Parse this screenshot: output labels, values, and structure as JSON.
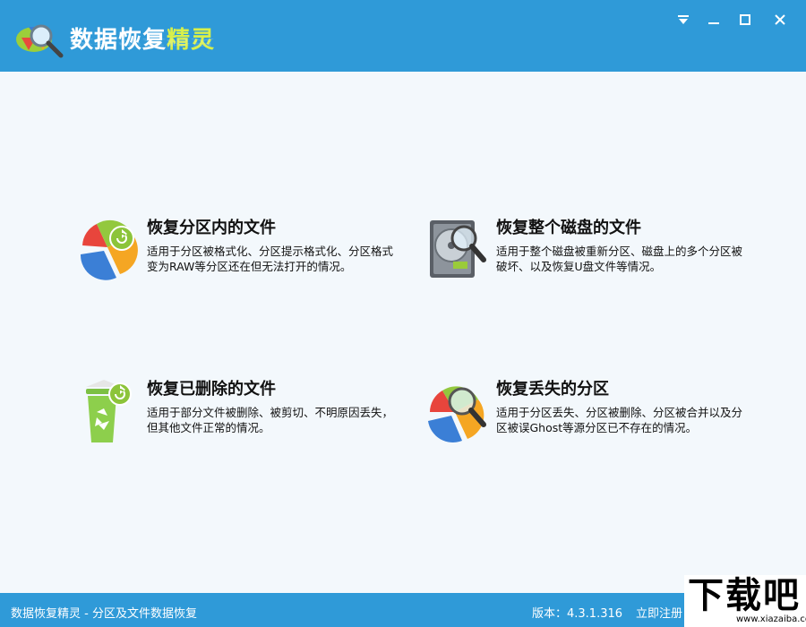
{
  "window": {
    "title_main": "数据恢复",
    "title_highlight": "精灵",
    "controls": [
      "menu",
      "minimize",
      "maximize",
      "close"
    ]
  },
  "cards": [
    {
      "title": "恢复分区内的文件",
      "description": "适用于分区被格式化、分区提示格式化、分区格式变为RAW等分区还在但无法打开的情况。",
      "icon": "partition-recover-icon"
    },
    {
      "title": "恢复整个磁盘的文件",
      "description": "适用于整个磁盘被重新分区、磁盘上的多个分区被破坏、以及恢复U盘文件等情况。",
      "icon": "disk-search-icon"
    },
    {
      "title": "恢复已删除的文件",
      "description": "适用于部分文件被删除、被剪切、不明原因丢失，但其他文件正常的情况。",
      "icon": "recycle-bin-icon"
    },
    {
      "title": "恢复丢失的分区",
      "description": "适用于分区丢失、分区被删除、分区被合并以及分区被误Ghost等源分区已不存在的情况。",
      "icon": "partition-search-icon"
    }
  ],
  "status": {
    "left": "数据恢复精灵 - 分区及文件数据恢复",
    "version": "版本：4.3.1.316",
    "register": "立即注册"
  },
  "watermark": {
    "big": "下载吧",
    "small": "www.xiazaiba.com"
  },
  "colors": {
    "titlebar": "#2f9ad8",
    "background": "#f3f8fc",
    "highlight": "#d8f04a"
  }
}
